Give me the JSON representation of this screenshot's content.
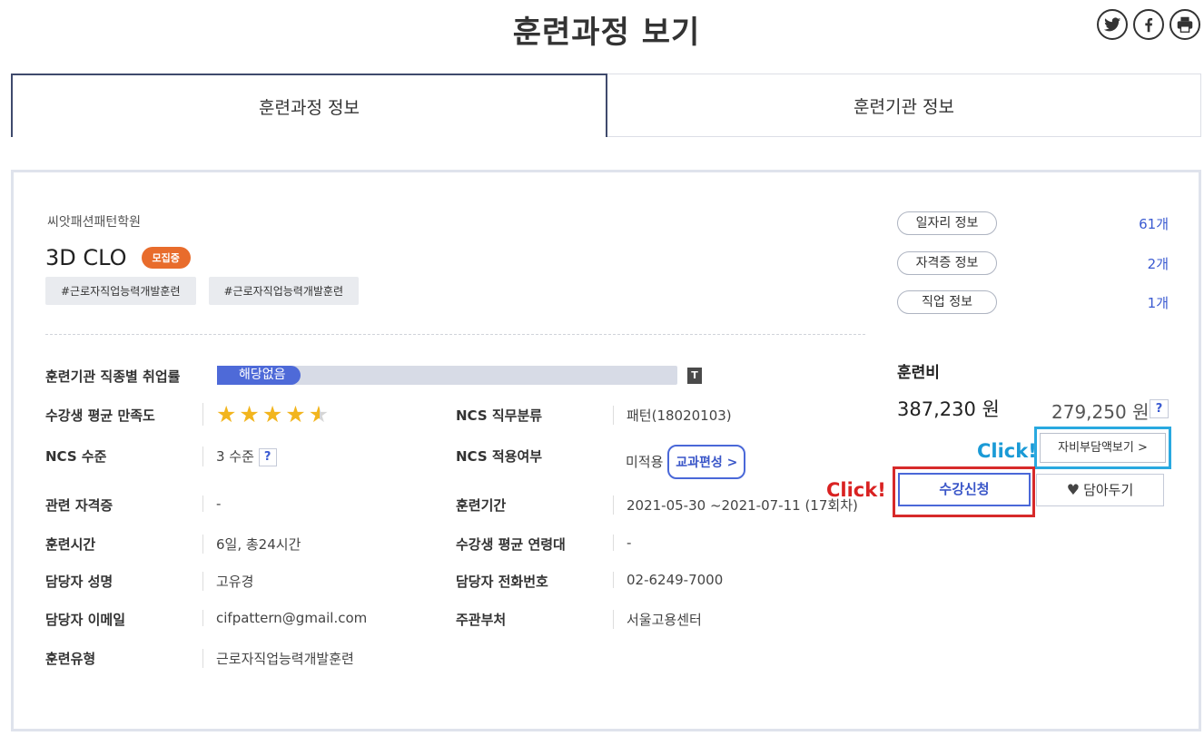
{
  "header": {
    "title": "훈련과정 보기"
  },
  "share": [
    {
      "name": "twitter-icon"
    },
    {
      "name": "facebook-icon"
    },
    {
      "name": "print-icon"
    }
  ],
  "tabs": [
    {
      "label": "훈련과정 정보",
      "active": true
    },
    {
      "label": "훈련기관 정보",
      "active": false
    }
  ],
  "course": {
    "org": "씨앗패션패턴학원",
    "title": "3D CLO",
    "status_badge": "모집중",
    "tags": [
      "#근로자직업능력개발훈련",
      "#근로자직업능력개발훈련"
    ]
  },
  "details": {
    "employment_rate": {
      "label": "훈련기관 직종별 취업률",
      "value": "해당없음",
      "t_label": "T"
    },
    "satisfaction": {
      "label": "수강생 평균 만족도",
      "rating": 4.5,
      "max": 5
    },
    "ncs_class": {
      "label": "NCS 직무분류",
      "value": "패턴(18020103)"
    },
    "ncs_level": {
      "label": "NCS 수준",
      "value": "3 수준",
      "help": "?"
    },
    "ncs_applied": {
      "label": "NCS 적용여부",
      "value": "미적용",
      "button": "교과편성 >"
    },
    "certificate": {
      "label": "관련 자격증",
      "value": "-"
    },
    "period": {
      "label": "훈련기간",
      "value": "2021-05-30 ~2021-07-11 (17회차)"
    },
    "hours": {
      "label": "훈련시간",
      "value": "6일, 총24시간"
    },
    "avg_age": {
      "label": "수강생 평균 연령대",
      "value": "-"
    },
    "manager": {
      "label": "담당자 성명",
      "value": "고유경"
    },
    "phone": {
      "label": "담당자 전화번호",
      "value": "02-6249-7000"
    },
    "email": {
      "label": "담당자 이메일",
      "value": "cifpattern@gmail.com"
    },
    "dept": {
      "label": "주관부처",
      "value": "서울고용센터"
    },
    "type": {
      "label": "훈련유형",
      "value": "근로자직업능력개발훈련"
    }
  },
  "side": {
    "info": [
      {
        "label": "일자리 정보",
        "count": "61개"
      },
      {
        "label": "자격증 정보",
        "count": "2개"
      },
      {
        "label": "직업 정보",
        "count": "1개"
      }
    ],
    "fee_label": "훈련비",
    "fee_total": "387,230 원",
    "fee_self": "279,250 원",
    "fee_help": "?",
    "selfpay_button": "자비부담액보기 >",
    "apply_button": "수강신청",
    "wish_button": "담아두기",
    "click_note_blue": "Click!",
    "click_note_red": "Click!"
  },
  "colors": {
    "accent": "#4a68d8",
    "badge": "#e86c2c",
    "star": "#f2b51e",
    "highlight_blue": "#29a9e0",
    "highlight_red": "#d72a2a"
  }
}
